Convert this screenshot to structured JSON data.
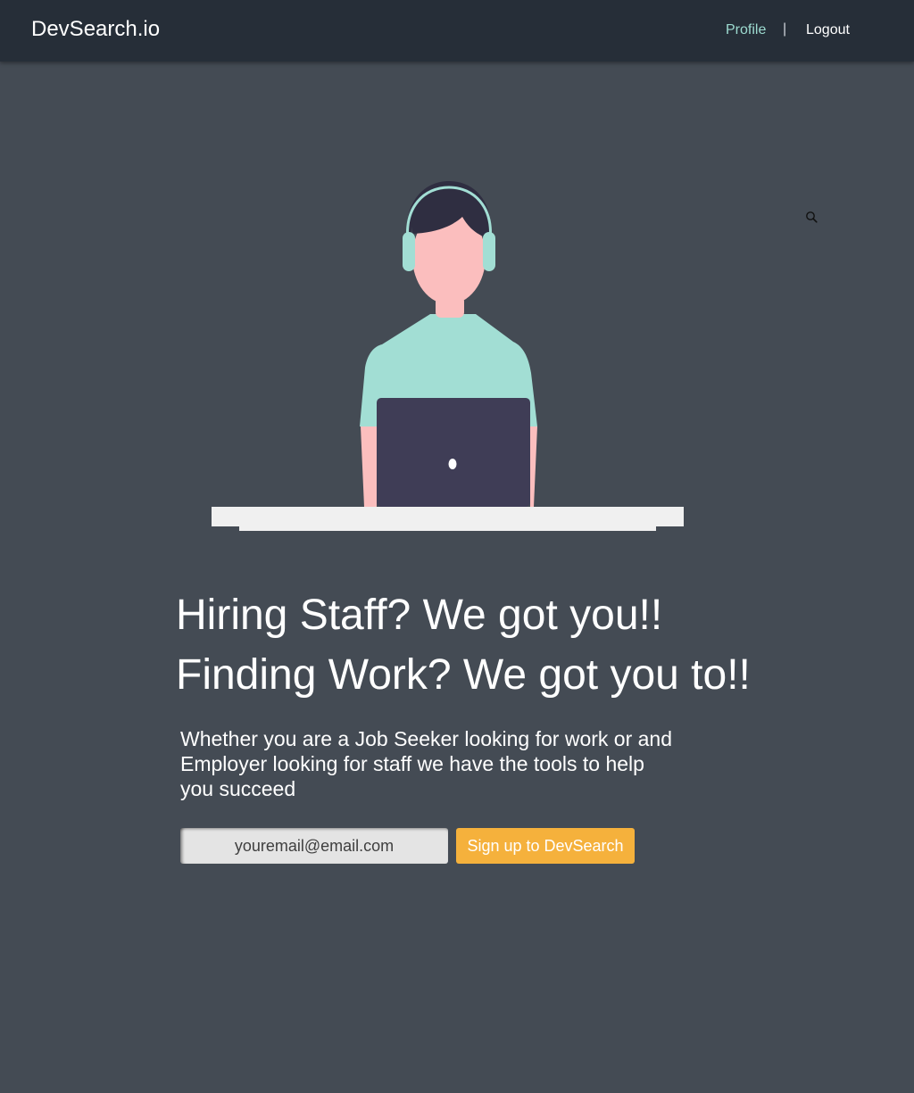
{
  "header": {
    "brand": "DevSearch.io",
    "nav": {
      "profile_label": "Profile",
      "separator": "|",
      "logout_label": "Logout"
    }
  },
  "hero": {
    "headline_1": "Hiring Staff? We got you!!",
    "headline_2": "Finding Work? We got you to!!",
    "tagline": "Whether you are a Job Seeker looking for work or and Employer looking for staff we have the tools to help you succeed"
  },
  "signup": {
    "email_placeholder": "youremail@email.com",
    "button_label": "Sign up to DevSearch"
  },
  "icons": {
    "search": "search-icon"
  },
  "colors": {
    "background": "#444b54",
    "navbar": "#262e38",
    "accent": "#9ddbd0",
    "button": "#f5b13c"
  }
}
